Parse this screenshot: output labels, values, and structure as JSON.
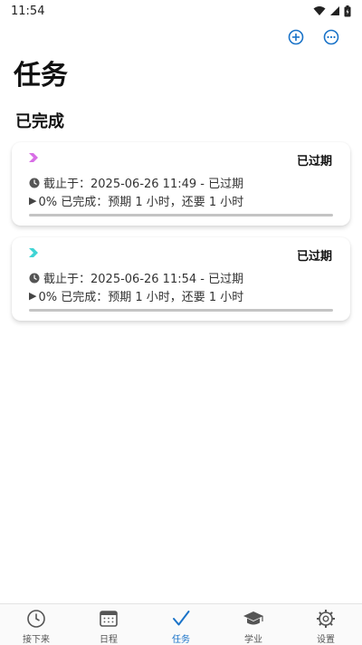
{
  "status_bar": {
    "time": "11:54"
  },
  "header": {
    "add_icon": "plus-circle-icon",
    "more_icon": "more-circle-icon",
    "accent_color": "#1a73c8"
  },
  "page": {
    "title": "任务",
    "section_title": "已完成"
  },
  "tasks": [
    {
      "chevron_color": "#d86ee6",
      "status": "已过期",
      "deadline": "截止于：2025-06-26 11:49 - 已过期",
      "progress_text": "0% 已完成：预期 1 小时，还要 1 小时",
      "progress": 0
    },
    {
      "chevron_color": "#3fd4d4",
      "status": "已过期",
      "deadline": "截止于：2025-06-26 11:54 - 已过期",
      "progress_text": "0% 已完成：预期 1 小时，还要 1 小时",
      "progress": 0
    }
  ],
  "nav": {
    "active_color": "#1a73c8",
    "items": [
      {
        "label": "接下来",
        "icon": "clock-icon"
      },
      {
        "label": "日程",
        "icon": "calendar-icon"
      },
      {
        "label": "任务",
        "icon": "checkmark-icon",
        "active": true
      },
      {
        "label": "学业",
        "icon": "graduation-cap-icon"
      },
      {
        "label": "设置",
        "icon": "gear-icon"
      }
    ]
  }
}
